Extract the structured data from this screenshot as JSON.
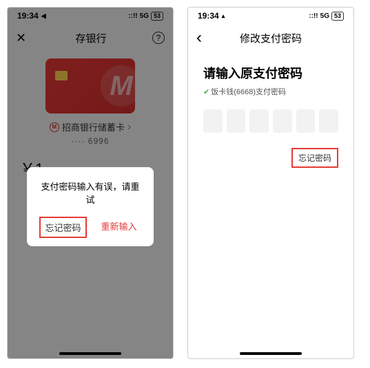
{
  "screen1": {
    "status": {
      "time": "19:34",
      "indicator": "◀",
      "signal": "::!!",
      "network": "5G",
      "battery": "53"
    },
    "nav": {
      "title": "存银行",
      "close": "✕",
      "help": "?"
    },
    "card": {
      "logoLetter": "M",
      "bankIcon": "M",
      "bankName": "招商银行储蓄卡",
      "chevron": "›",
      "maskedDigits": "···· 6996"
    },
    "amount": "￥1",
    "dialog": {
      "message": "支付密码输入有误，请重试",
      "forgot": "忘记密码",
      "retry": "重新输入"
    }
  },
  "screen2": {
    "status": {
      "time": "19:34",
      "indicator": "▴",
      "signal": "::!!",
      "network": "5G",
      "battery": "53"
    },
    "nav": {
      "back": "‹",
      "title": "修改支付密码"
    },
    "heading": "请输入原支付密码",
    "subIcon": "✔",
    "subtext": "饭卡钱(6668)支付密码",
    "forgotLink": "忘记密码"
  }
}
